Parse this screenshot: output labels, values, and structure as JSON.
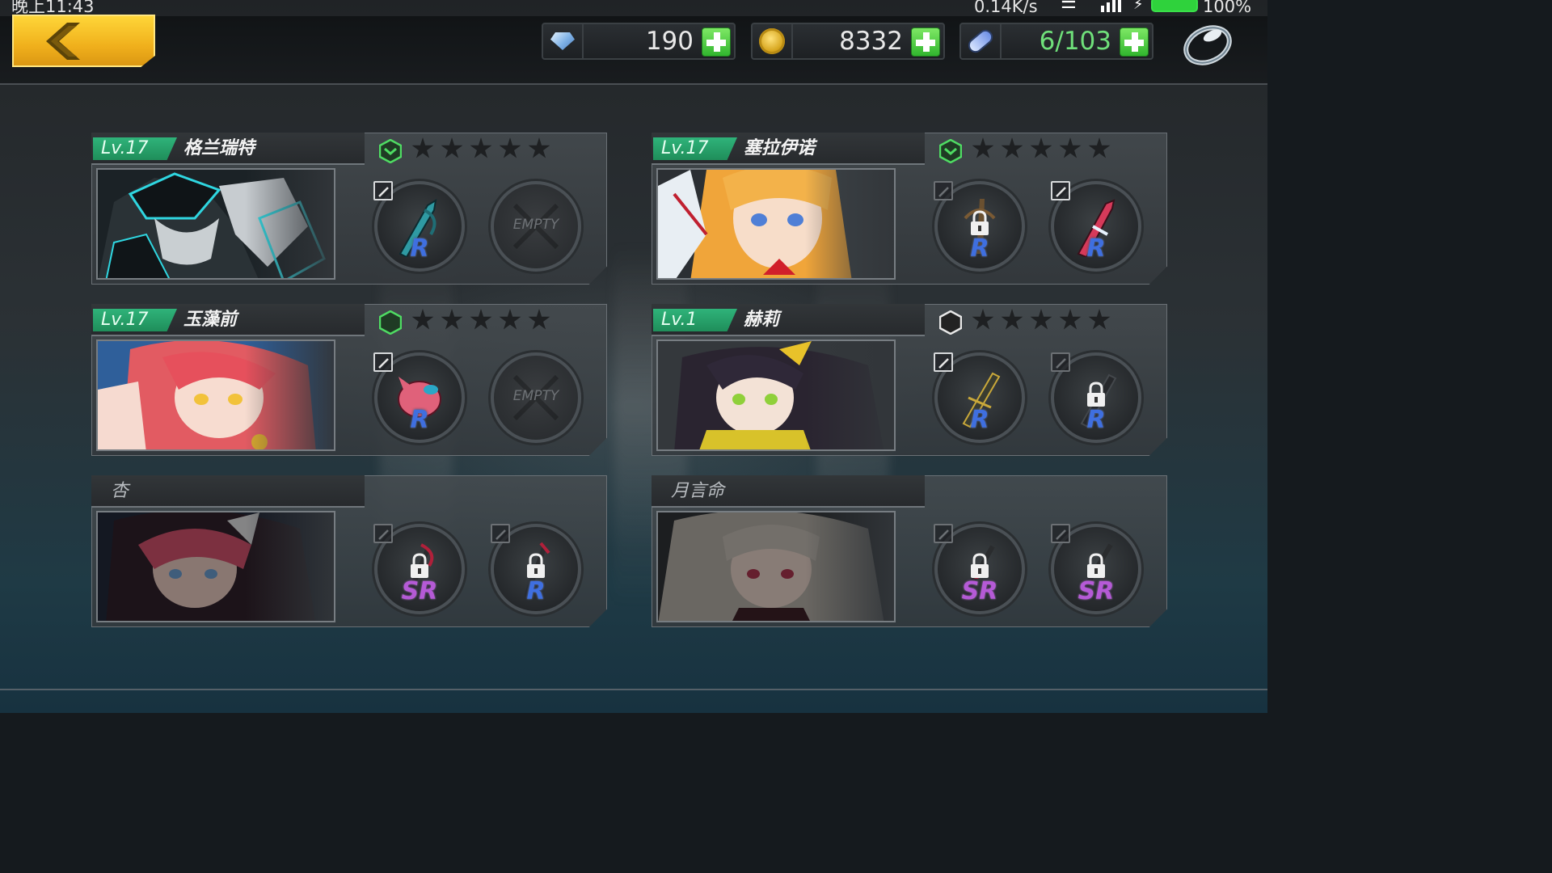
{
  "status_bar": {
    "time": "晚上11:43",
    "network_speed": "0.14K/s",
    "battery_percent": "100%"
  },
  "top_bar": {
    "back_icon": "chevron-left-icon",
    "resources": [
      {
        "icon": "diamond-icon",
        "value": "190",
        "plus_icon": "plus-icon"
      },
      {
        "icon": "gold-coin-icon",
        "value": "8332",
        "plus_icon": "plus-icon"
      },
      {
        "icon": "stamina-vial-icon",
        "value": "6/103",
        "plus_icon": "plus-icon"
      }
    ],
    "ring_icon": "ring-icon"
  },
  "characters": [
    {
      "level": "Lv.17",
      "name": "格兰瑞特",
      "unlocked": true,
      "rank_icon": "green-chevron-hex-icon",
      "stars_filled": 0,
      "stars_total": 5,
      "slots": [
        {
          "state": "equipped",
          "rarity": "R"
        },
        {
          "state": "empty",
          "text": "EMPTY"
        }
      ]
    },
    {
      "level": "Lv.17",
      "name": "塞拉伊诺",
      "unlocked": true,
      "rank_icon": "green-chevron-hex-icon",
      "stars_filled": 0,
      "stars_total": 5,
      "slots": [
        {
          "state": "locked",
          "rarity": "R"
        },
        {
          "state": "equipped",
          "rarity": "R"
        }
      ]
    },
    {
      "level": "Lv.17",
      "name": "玉藻前",
      "unlocked": true,
      "rank_icon": "green-hex-icon",
      "stars_filled": 0,
      "stars_total": 5,
      "slots": [
        {
          "state": "equipped",
          "rarity": "R"
        },
        {
          "state": "empty",
          "text": "EMPTY"
        }
      ]
    },
    {
      "level": "Lv.1",
      "name": "赫莉",
      "unlocked": true,
      "rank_icon": "white-hex-icon",
      "stars_filled": 0,
      "stars_total": 5,
      "slots": [
        {
          "state": "equipped",
          "rarity": "R"
        },
        {
          "state": "locked",
          "rarity": "R"
        }
      ]
    },
    {
      "name": "杏",
      "unlocked": false,
      "slots": [
        {
          "state": "locked",
          "rarity": "SR"
        },
        {
          "state": "locked",
          "rarity": "R"
        }
      ]
    },
    {
      "name": "月言命",
      "unlocked": false,
      "slots": [
        {
          "state": "locked",
          "rarity": "SR"
        },
        {
          "state": "locked",
          "rarity": "SR"
        }
      ]
    }
  ],
  "colors": {
    "level_badge": "#1f8e5a",
    "back_button": "#f5c128",
    "plus_button": "#36b832",
    "rarity_R": "#3f6fe0",
    "rarity_SR": "#b55ad6"
  }
}
